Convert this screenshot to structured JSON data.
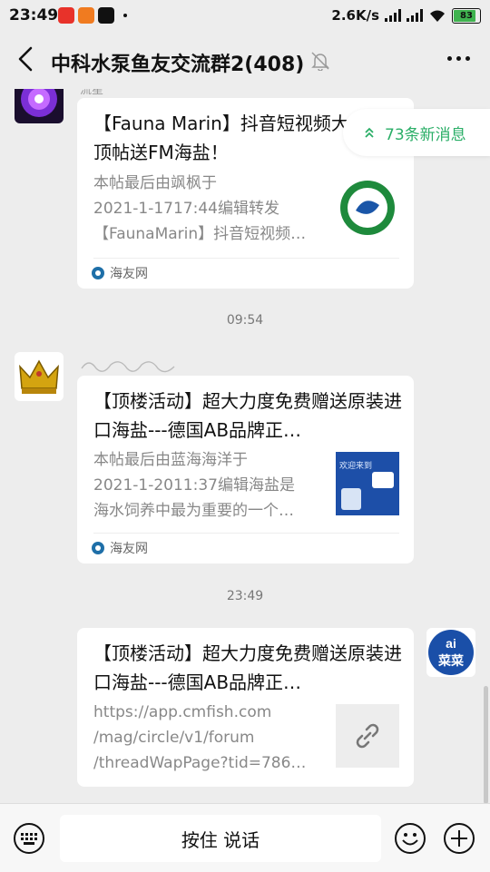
{
  "status_bar": {
    "time": "23:49",
    "net_speed": "2.6K/s",
    "battery": "83",
    "app_icons": [
      "app-icon-red",
      "app-icon-orange",
      "app-icon-tiktok"
    ]
  },
  "header": {
    "title": "中科水泵鱼友交流群2(408)",
    "icons": [
      "back-arrow-icon",
      "mute-bell-icon",
      "more-icon"
    ]
  },
  "new_messages": "73条新消息",
  "messages": [
    {
      "title": "【Fauna Marin】抖音短视频大赛。顶帖送FM海盐！",
      "desc_lines": [
        "本帖最后由飒枫于",
        "2021-1-1717:44编辑转发",
        "【FaunaMarin】抖音短视频…"
      ],
      "source": "海友网",
      "sender_label": "流星"
    },
    {
      "timestamp": "09:54"
    },
    {
      "title": "【顶楼活动】超大力度免费赠送原装进口海盐---德国AB品牌正…",
      "desc_lines": [
        "本帖最后由蓝海海洋于",
        "2021-1-2011:37编辑海盐是",
        "海水饲养中最为重要的一个…"
      ],
      "source": "海友网",
      "thumb_text": "欢迎来到"
    },
    {
      "timestamp": "23:49"
    },
    {
      "title": "【顶楼活动】超大力度免费赠送原装进口海盐---德国AB品牌正…",
      "desc_lines": [
        "https://app.cmfish.com",
        "/mag/circle/v1/forum",
        "/threadWapPage?tid=786…"
      ],
      "avatar_text": "菜菜"
    }
  ],
  "bottom": {
    "hold_to_talk": "按住 说话",
    "icons": [
      "keyboard-icon",
      "emoji-icon",
      "plus-icon"
    ]
  },
  "colors": {
    "accent_green": "#2aae67",
    "background": "#ededed",
    "card": "#ffffff"
  }
}
